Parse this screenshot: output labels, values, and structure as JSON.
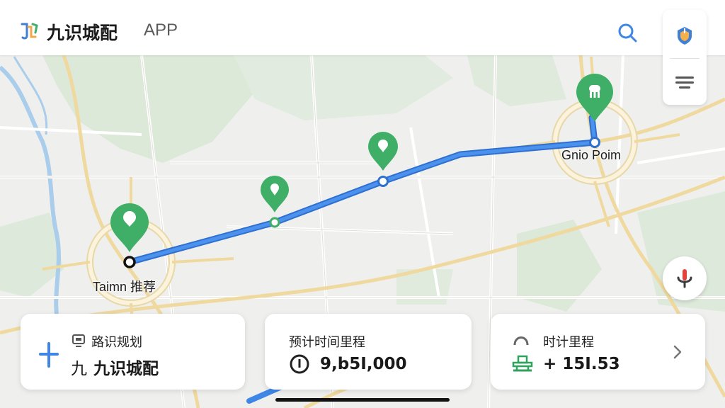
{
  "header": {
    "app_name": "九识城配",
    "app_suffix": "APP"
  },
  "map": {
    "labels": {
      "start": "Taimn 推荐",
      "end": "Gnio Poim"
    },
    "route_color": "#3f86e6",
    "marker_color": "#3fae66"
  },
  "cards": [
    {
      "title": "路识规划",
      "prefix": "九",
      "value": "九识城配"
    },
    {
      "title": "预计时间里程",
      "value": "9,b5I,000"
    },
    {
      "title": "时计里程",
      "value": "+ 15I.53"
    }
  ],
  "icons": {
    "search": "search-icon",
    "shield": "shield-icon",
    "menu": "menu-icon",
    "mic": "microphone-icon",
    "chevron": "chevron-right-icon"
  }
}
